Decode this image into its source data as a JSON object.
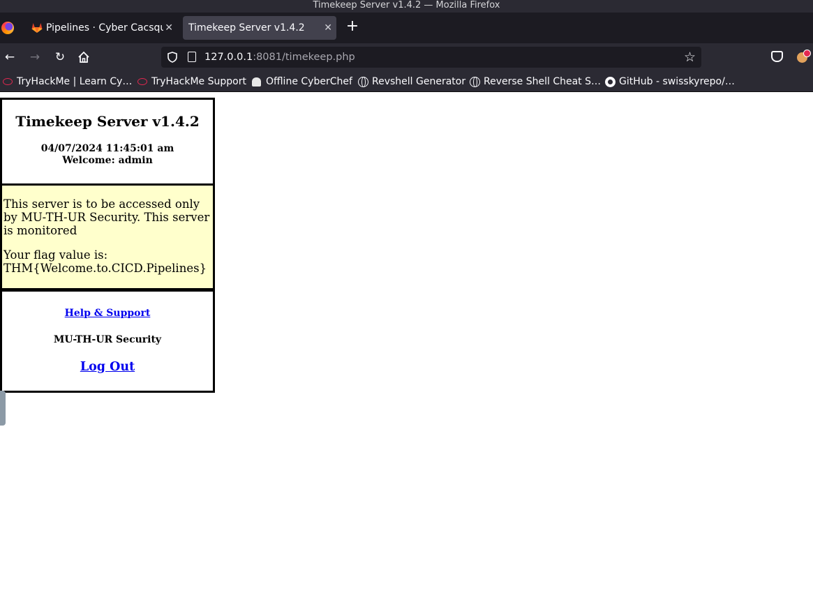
{
  "window": {
    "title": "Timekeep Server v1.4.2 — Mozilla Firefox"
  },
  "tabs": [
    {
      "label": "Pipelines · Cyber Cacsqua",
      "active": false,
      "icon": "gitlab-icon"
    },
    {
      "label": "Timekeep Server v1.4.2",
      "active": true
    }
  ],
  "urlbar": {
    "host": "127.0.0.1",
    "rest": ":8081/timekeep.php"
  },
  "bookmarks": [
    {
      "label": "TryHackMe | Learn Cy…",
      "icon": "tryhackme-icon"
    },
    {
      "label": "TryHackMe Support",
      "icon": "tryhackme-icon"
    },
    {
      "label": "Offline CyberChef",
      "icon": "chef-icon"
    },
    {
      "label": "Revshell Generator",
      "icon": "globe-icon"
    },
    {
      "label": "Reverse Shell Cheat S…",
      "icon": "globe-icon"
    },
    {
      "label": "GitHub - swisskyrepo/…",
      "icon": "github-icon"
    }
  ],
  "page": {
    "title": "Timekeep Server v1.4.2",
    "datetime": "04/07/2024 11:45:01 am",
    "welcome": "Welcome: admin",
    "notice": "This server is to be accessed only by MU-TH-UR Security. This server is monitored",
    "flag_label": "Your flag value is:",
    "flag_value": "THM{Welcome.to.CICD.Pipelines}",
    "help_link": "Help & Support",
    "org": "MU-TH-UR Security",
    "logout_link": "Log Out"
  },
  "colors": {
    "notice_bg": "#ffffcc",
    "link": "#0000ee",
    "chrome_dark": "#1c1b22",
    "chrome": "#2b2a33"
  }
}
